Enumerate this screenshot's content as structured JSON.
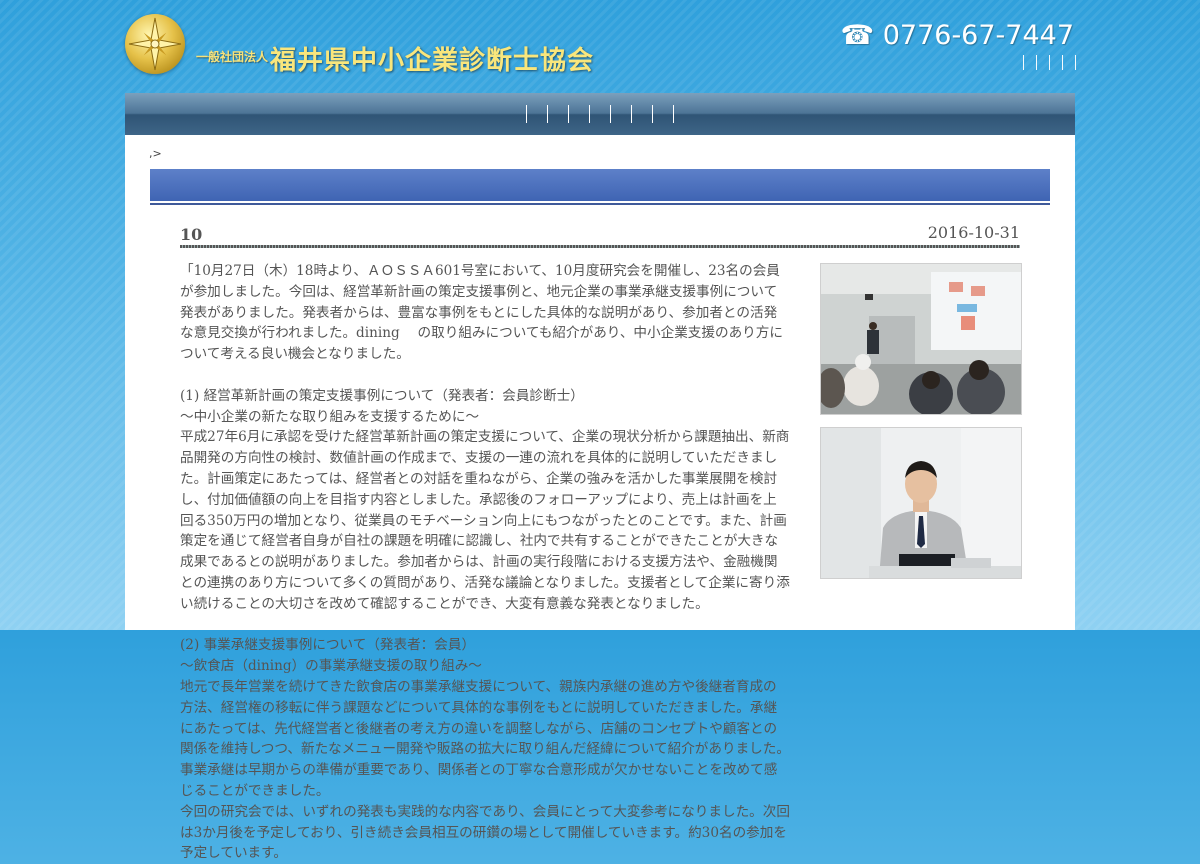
{
  "header": {
    "org_sub": "一般社団法人",
    "org_name": "福井県中小企業診断士協会",
    "phone": "☎ 0776-67-7447",
    "utility_links": [
      "",
      "",
      "",
      "",
      ""
    ]
  },
  "nav": {
    "items": [
      "",
      "",
      "",
      "",
      "",
      "",
      "",
      ""
    ]
  },
  "breadcrumb": ",>",
  "page_title": "",
  "post": {
    "title": "10",
    "date": "2016-10-31",
    "intro": "「10月27日（木）18時より、ＡＯＳＳＡ601号室において、10月度研究会を開催し、23名の会員が参加しました。今回は、経営革新計画の策定支援事例と、地元企業の事業承継支援事例について発表がありました。発表者からは、豊富な事例をもとにした具体的な説明があり、参加者との活発な意見交換が行われました。dining 　の取り組みについても紹介があり、中小企業支援のあり方について考える良い機会となりました。",
    "section1_heading": "(1) 経営革新計画の策定支援事例について（発表者：会員診断士）",
    "section1_sub": "～中小企業の新たな取り組みを支援するために～",
    "section1_body": "平成27年6月に承認を受けた経営革新計画の策定支援について、企業の現状分析から課題抽出、新商品開発の方向性の検討、数値計画の作成まで、支援の一連の流れを具体的に説明していただきました。計画策定にあたっては、経営者との対話を重ねながら、企業の強みを活かした事業展開を検討し、付加価値額の向上を目指す内容としました。承認後のフォローアップにより、売上は計画を上回る350万円の増加となり、従業員のモチベーション向上にもつながったとのことです。また、計画策定を通じて経営者自身が自社の課題を明確に認識し、社内で共有することができたことが大きな成果であるとの説明がありました。参加者からは、計画の実行段階における支援方法や、金融機関との連携のあり方について多くの質問があり、活発な議論となりました。支援者として企業に寄り添い続けることの大切さを改めて確認することができ、大変有意義な発表となりました。",
    "section2_heading": "(2) 事業承継支援事例について（発表者：会員）",
    "section2_sub": "～飲食店（dining）の事業承継支援の取り組み～",
    "section2_body": "地元で長年営業を続けてきた飲食店の事業承継支援について、親族内承継の進め方や後継者育成の方法、経営権の移転に伴う課題などについて具体的な事例をもとに説明していただきました。承継にあたっては、先代経営者と後継者の考え方の違いを調整しながら、店舗のコンセプトや顧客との関係を維持しつつ、新たなメニュー開発や販路の拡大に取り組んだ経緯について紹介がありました。事業承継は早期からの準備が重要であり、関係者との丁寧な合意形成が欠かせないことを改めて感じることができました。",
    "section2_tail": "今回の研究会では、いずれの発表も実践的な内容であり、会員にとって大変参考になりました。次回は3か月後を予定しており、引き続き会員相互の研鑽の場として開催していきます。約30名の参加を予定しています。"
  },
  "photos": [
    {
      "alt": "研究会の会場の様子"
    },
    {
      "alt": "発表者"
    }
  ]
}
